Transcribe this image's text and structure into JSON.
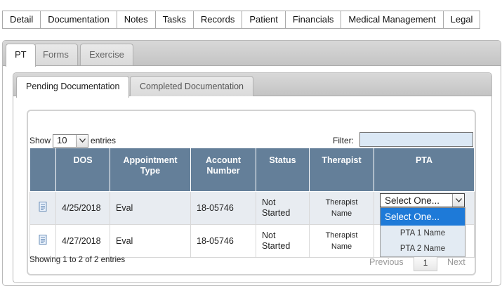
{
  "top_tabs": [
    "Detail",
    "Documentation",
    "Notes",
    "Tasks",
    "Records",
    "Patient",
    "Financials",
    "Medical Management",
    "Legal"
  ],
  "sub_tabs": [
    "PT",
    "Forms",
    "Exercise"
  ],
  "doc_tabs": [
    "Pending Documentation",
    "Completed Documentation"
  ],
  "length": {
    "show_label": "Show",
    "value": "10",
    "entries_label": "entries"
  },
  "filter": {
    "label": "Filter:",
    "value": ""
  },
  "table": {
    "headers": {
      "dos": "DOS",
      "appt_line1": "Appointment",
      "appt_line2": "Type",
      "acct_line1": "Account",
      "acct_line2": "Number",
      "status": "Status",
      "therapist": "Therapist",
      "pta": "PTA"
    },
    "rows": [
      {
        "dos": "4/25/2018",
        "type": "Eval",
        "account": "18-05746",
        "status_line1": "Not",
        "status_line2": "Started",
        "therapist_line1": "Therapist",
        "therapist_line2": "Name"
      },
      {
        "dos": "4/27/2018",
        "type": "Eval",
        "account": "18-05746",
        "status_line1": "Not",
        "status_line2": "Started",
        "therapist_line1": "Therapist",
        "therapist_line2": "Name"
      }
    ]
  },
  "pta_select": {
    "value": "Select One...",
    "options": [
      "Select One...",
      "PTA 1 Name",
      "PTA 2 Name"
    ]
  },
  "info": "Showing 1 to 2 of 2 entries",
  "pager": {
    "previous": "Previous",
    "page": "1",
    "next": "Next"
  },
  "colors": {
    "header_bg": "#647f99",
    "row_alt": "#e8ecf1",
    "selected_option": "#1e7ad8",
    "filter_bg": "#dbe8f5"
  },
  "icons": {
    "row_action": "document-icon",
    "dropdown": "chevron-down-icon"
  }
}
